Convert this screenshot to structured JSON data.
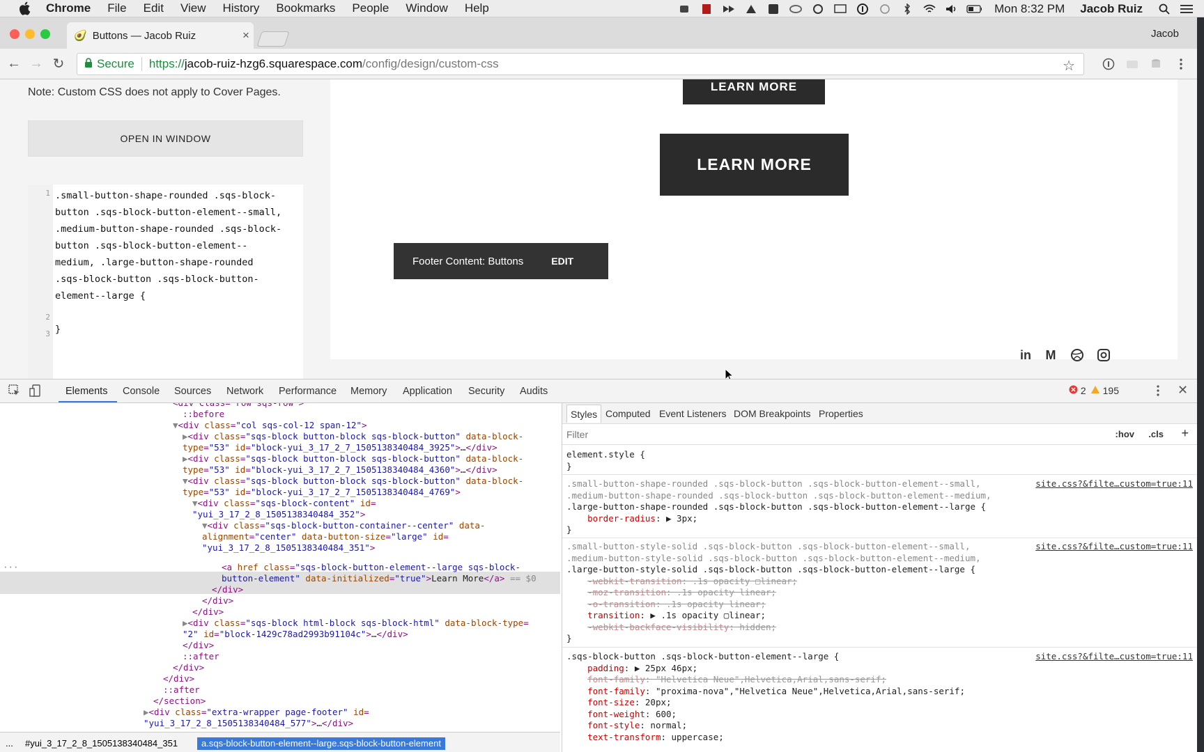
{
  "menubar": {
    "app": "Chrome",
    "items": [
      "File",
      "Edit",
      "View",
      "History",
      "Bookmarks",
      "People",
      "Window",
      "Help"
    ],
    "clock": "Mon 8:32 PM",
    "user": "Jacob Ruiz"
  },
  "browser": {
    "tab_title": "Buttons — Jacob Ruiz",
    "profile": "Jacob",
    "secure_label": "Secure",
    "url_scheme": "https://",
    "url_host": "jacob-ruiz-hzg6.squarespace.com",
    "url_path": "/config/design/custom-css"
  },
  "page": {
    "note": "Note: Custom CSS does not apply to Cover Pages.",
    "open_window": "OPEN IN WINDOW",
    "code_lines": [
      ".small-button-shape-rounded .sqs-block-",
      "button .sqs-block-button-element--small,",
      ".medium-button-shape-rounded .sqs-block-",
      "button .sqs-block-button-element--",
      "medium, .large-button-shape-rounded",
      ".sqs-block-button .sqs-block-button-",
      "element--large {",
      "",
      "}"
    ],
    "line_numbers": [
      "1",
      "2",
      "3"
    ],
    "learn_more_top": "LEARN MORE",
    "learn_more": "LEARN MORE",
    "footer_label": "Footer Content: Buttons",
    "footer_edit": "EDIT",
    "social_icons": [
      "linkedin-icon",
      "medium-icon",
      "dribbble-icon",
      "instagram-icon"
    ]
  },
  "devtools": {
    "tabs": [
      "Elements",
      "Console",
      "Sources",
      "Network",
      "Performance",
      "Memory",
      "Application",
      "Security",
      "Audits"
    ],
    "errors": "2",
    "warnings": "195",
    "breadcrumb_left": "...",
    "breadcrumb_id": "#yui_3_17_2_8_1505138340484_351",
    "breadcrumb_selected": "a.sqs-block-button-element--large.sqs-block-button-element",
    "styles_tabs": [
      "Styles",
      "Computed",
      "Event Listeners",
      "DOM Breakpoints",
      "Properties"
    ],
    "filter_placeholder": "Filter",
    "hov": ":hov",
    "cls": ".cls",
    "source_link": "site.css?&filte…custom=true:11"
  }
}
